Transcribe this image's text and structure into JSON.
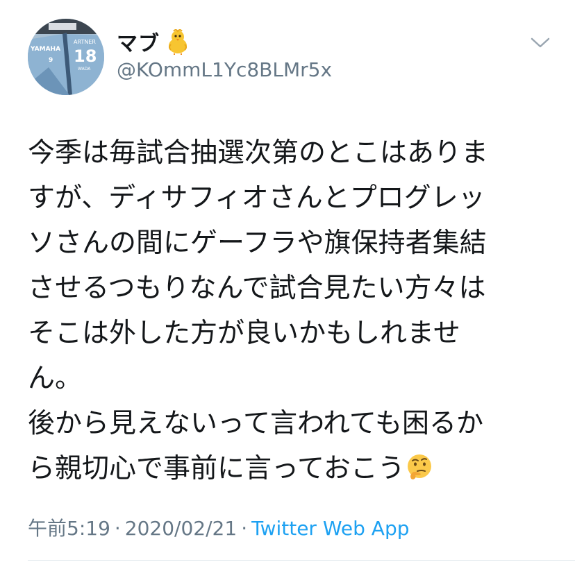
{
  "tweet": {
    "display_name": "マブ",
    "handle": "@KOmmL1Yc8BLMr5x",
    "avatar_jersey": {
      "brand": "YAMAHA",
      "number": "18",
      "name_top": "ARTNER",
      "name_bottom": "WADA",
      "small_number": "9"
    },
    "body_lines": [
      "今季は毎試合抽選次第のとこはありま",
      "すが、ディサフィオさんとプログレッ",
      "ソさんの間にゲーフラや旗保持者集結",
      "させるつもりなんで試合見たい方々は",
      "そこは外した方が良いかもしれませ",
      "ん。",
      "後から見えないって言われても困るか",
      "ら親切心で事前に言っておこう"
    ],
    "time": "午前5:19",
    "separator": "·",
    "date": "2020/02/21",
    "source": "Twitter Web App",
    "icons": {
      "name_emoji": "baby-chick-icon",
      "body_emoji": "thinking-face-icon",
      "menu": "chevron-down-icon"
    },
    "colors": {
      "text": "#14171a",
      "secondary": "#657786",
      "link": "#1da1f2"
    }
  }
}
